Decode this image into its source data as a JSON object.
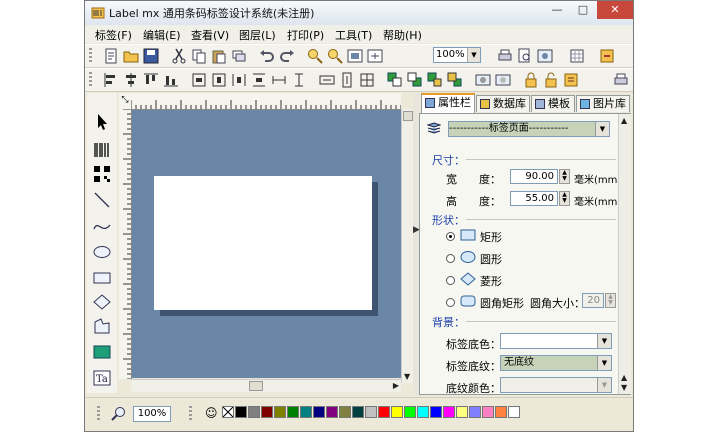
{
  "window": {
    "title": "Label mx 通用条码标签设计系统(未注册)",
    "minimize_glyph": "—",
    "maximize_glyph": "□",
    "close_glyph": "✕"
  },
  "menu": [
    "标签(F)",
    "编辑(E)",
    "查看(V)",
    "图层(L)",
    "打印(P)",
    "工具(T)",
    "帮助(H)"
  ],
  "toolbar": {
    "zoom_value": "100%"
  },
  "panel": {
    "tabs": [
      "属性栏",
      "数据库",
      "模板",
      "图片库"
    ],
    "active_tab": "属性栏",
    "object_select": "-----------标签页面-----------",
    "size": {
      "section": "尺寸：",
      "width_label": "宽　　度：",
      "width_value": "90.00",
      "width_unit": "毫米(mm)",
      "height_label": "高　　度：",
      "height_value": "55.00",
      "height_unit": "毫米(mm)"
    },
    "shape": {
      "section": "形状：",
      "options": [
        "矩形",
        "圆形",
        "菱形",
        "圆角矩形"
      ],
      "selected": "矩形",
      "corner_label": "圆角大小：",
      "corner_value": "20"
    },
    "background": {
      "section": "背景：",
      "bg_color_label": "标签底色：",
      "bg_color_value": "",
      "bg_pattern_label": "标签底纹：",
      "bg_pattern_value": "无底纹",
      "pattern_color_label": "底纹颜色：",
      "pattern_color_value": ""
    }
  },
  "status": {
    "zoom": "100%"
  },
  "palette": [
    "#000000",
    "#808080",
    "#800000",
    "#808000",
    "#008000",
    "#008080",
    "#000080",
    "#800080",
    "#808040",
    "#004040",
    "#c0c0c0",
    "#ff0000",
    "#ffff00",
    "#00ff00",
    "#00ffff",
    "#0000ff",
    "#ff00ff",
    "#ffff80",
    "#8080ff",
    "#ff80c0",
    "#ff8040",
    "#ffffff"
  ],
  "colors": {
    "canvas": "#6b87a8",
    "active_tab_accent": "#e69c2b",
    "section_text": "#1a3ea8"
  }
}
